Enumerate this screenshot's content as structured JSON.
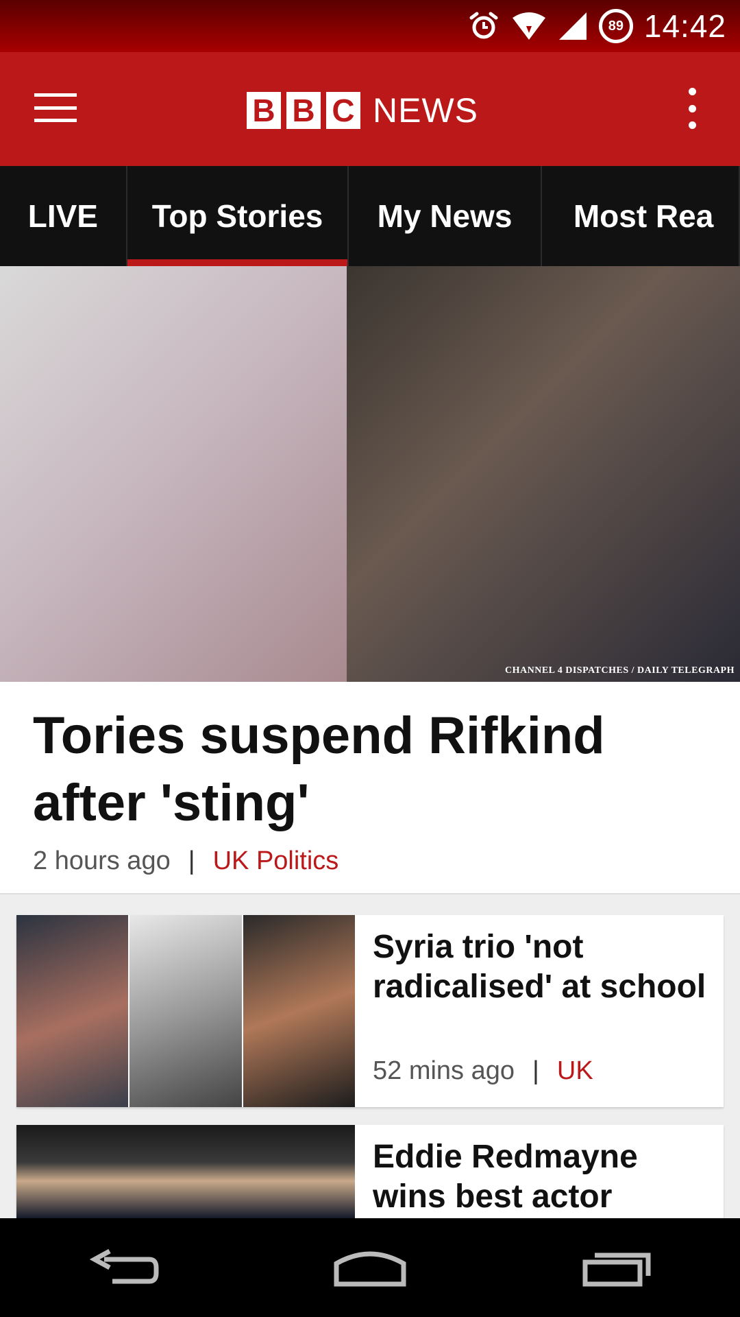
{
  "status_bar": {
    "time": "14:42",
    "battery": "89",
    "icons": [
      "alarm-icon",
      "wifi-icon",
      "signal-icon",
      "battery-icon"
    ]
  },
  "app_bar": {
    "logo_letters": [
      "B",
      "B",
      "C"
    ],
    "logo_word": "NEWS"
  },
  "tabs": [
    {
      "label": "LIVE",
      "active": false
    },
    {
      "label": "Top Stories",
      "active": true
    },
    {
      "label": "My News",
      "active": false
    },
    {
      "label": "Most Rea",
      "active": false
    }
  ],
  "hero": {
    "credit": "CHANNEL 4 DISPATCHES / DAILY TELEGRAPH",
    "title": "Tories suspend Rifkind after 'sting'",
    "time": "2 hours ago",
    "separator": "|",
    "section": "UK Politics"
  },
  "stories": [
    {
      "title": "Syria trio 'not radicalised' at school",
      "time": "52 mins ago",
      "separator": "|",
      "section": "UK"
    },
    {
      "title": "Eddie Redmayne wins best actor",
      "time": "",
      "separator": "",
      "section": ""
    }
  ],
  "colors": {
    "brand_red": "#bb1919",
    "tab_bg": "#111111",
    "nav_bg": "#000000"
  },
  "nav_bar": {
    "icons": [
      "back-icon",
      "home-icon",
      "recents-icon"
    ]
  }
}
